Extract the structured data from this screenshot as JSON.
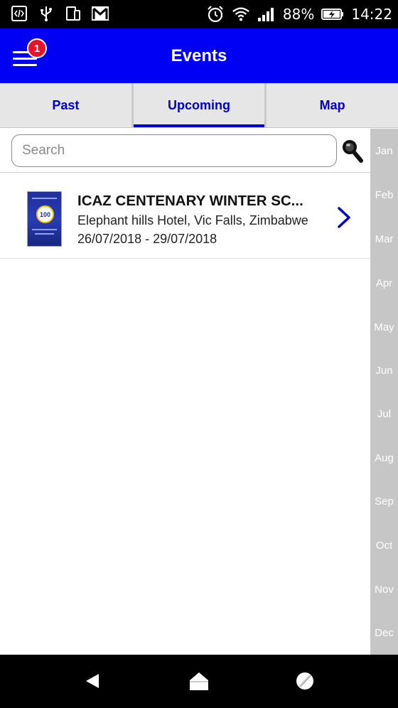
{
  "status_bar": {
    "battery": "88%",
    "time": "14:22",
    "left_icons": [
      "code-icon",
      "usb-icon",
      "devices-icon",
      "gmail-icon"
    ],
    "right_icons": [
      "alarm-icon",
      "wifi-icon",
      "signal-icon",
      "battery-charging-icon"
    ]
  },
  "app_bar": {
    "title": "Events",
    "menu_badge": "1",
    "background": "#0000f5",
    "badge_color": "#e8132b"
  },
  "tabs": [
    {
      "label": "Past",
      "active": false
    },
    {
      "label": "Upcoming",
      "active": true
    },
    {
      "label": "Map",
      "active": false
    }
  ],
  "search": {
    "placeholder": "Search",
    "value": ""
  },
  "events": [
    {
      "title": "ICAZ CENTENARY WINTER SC...",
      "venue": "Elephant hills Hotel, Vic Falls, Zimbabwe",
      "dates": "26/07/2018 - 29/07/2018",
      "thumbnail_badge": "100"
    }
  ],
  "month_index": [
    "Jan",
    "Feb",
    "Mar",
    "Apr",
    "May",
    "Jun",
    "Jul",
    "Aug",
    "Sep",
    "Oct",
    "Nov",
    "Dec"
  ],
  "accent_color": "#0000cc",
  "nav_bar": {
    "icons": [
      "back-icon",
      "home-icon",
      "recents-icon"
    ]
  }
}
